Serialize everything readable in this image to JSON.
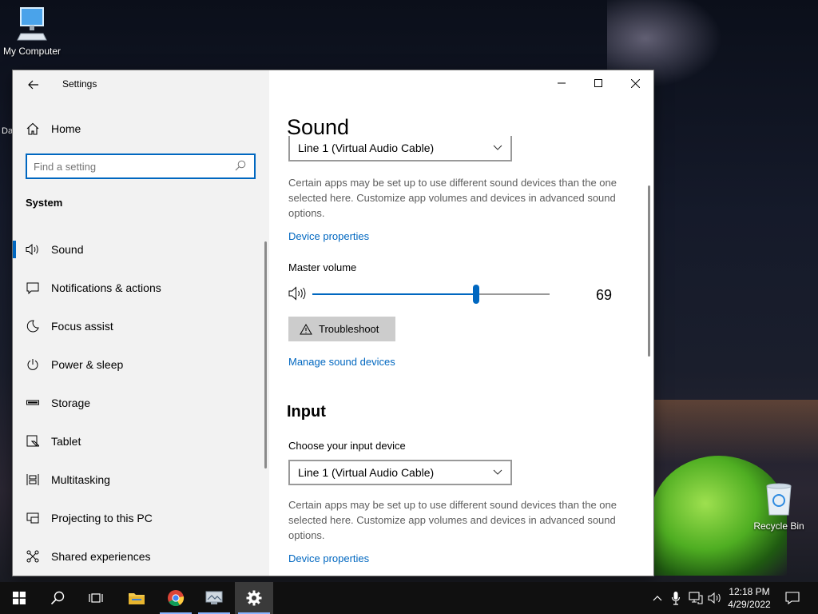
{
  "desktop": {
    "icons": [
      {
        "label": "My Computer"
      },
      {
        "label": "Recycle Bin"
      }
    ],
    "partial_label": "Da"
  },
  "window": {
    "title": "Settings",
    "back_icon": "arrow-left-icon",
    "buttons": {
      "minimize": "minimize-icon",
      "maximize": "maximize-icon",
      "close": "close-icon"
    }
  },
  "sidebar": {
    "home_label": "Home",
    "search_placeholder": "Find a setting",
    "section": "System",
    "items": [
      {
        "label": "Sound",
        "icon": "speaker-icon",
        "active": true
      },
      {
        "label": "Notifications & actions",
        "icon": "message-icon"
      },
      {
        "label": "Focus assist",
        "icon": "moon-icon"
      },
      {
        "label": "Power & sleep",
        "icon": "power-icon"
      },
      {
        "label": "Storage",
        "icon": "storage-icon"
      },
      {
        "label": "Tablet",
        "icon": "tablet-icon"
      },
      {
        "label": "Multitasking",
        "icon": "multitasking-icon"
      },
      {
        "label": "Projecting to this PC",
        "icon": "projector-icon"
      },
      {
        "label": "Shared experiences",
        "icon": "shared-icon"
      }
    ]
  },
  "content": {
    "title": "Sound",
    "output": {
      "device": "Line 1 (Virtual Audio Cable)",
      "description": "Certain apps may be set up to use different sound devices than the one selected here. Customize app volumes and devices in advanced sound options.",
      "device_properties_link": "Device properties",
      "master_volume_label": "Master volume",
      "volume": 69,
      "volume_text": "69",
      "troubleshoot_label": "Troubleshoot",
      "manage_link": "Manage sound devices"
    },
    "input": {
      "heading": "Input",
      "choose_label": "Choose your input device",
      "device": "Line 1 (Virtual Audio Cable)",
      "description": "Certain apps may be set up to use different sound devices than the one selected here. Customize app volumes and devices in advanced sound options.",
      "device_properties_link": "Device properties"
    }
  },
  "taskbar": {
    "apps": [
      "windows-start-icon",
      "search-icon",
      "task-view-icon",
      "file-explorer-icon",
      "chrome-icon",
      "monitor-app-icon",
      "settings-gear-icon"
    ],
    "tray": [
      "chevron-up-icon",
      "microphone-icon",
      "network-icon",
      "volume-icon"
    ],
    "time": "12:18 PM",
    "date": "4/29/2022",
    "notification_icon": "action-center-icon"
  },
  "colors": {
    "accent": "#0067c0",
    "taskbar": "#101010",
    "sidebar": "#f2f2f2"
  }
}
